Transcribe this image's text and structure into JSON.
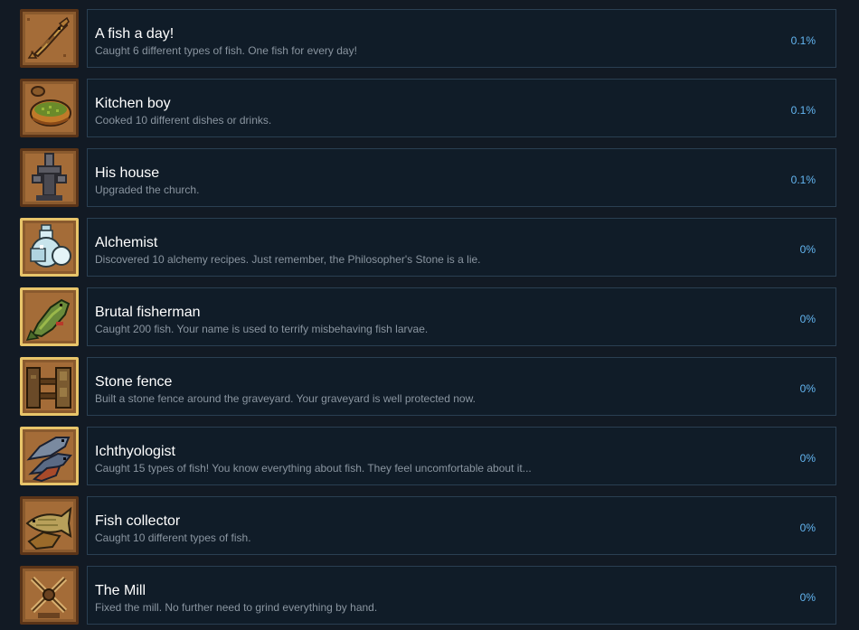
{
  "achievements": [
    {
      "icon": "fish-icon",
      "title": "A fish a day!",
      "description": "Caught 6 different types of fish. One fish for every day!",
      "percent": "0.1%"
    },
    {
      "icon": "soup-bowl-icon",
      "title": "Kitchen boy",
      "description": "Cooked 10 different dishes or drinks.",
      "percent": "0.1%"
    },
    {
      "icon": "church-icon",
      "title": "His house",
      "description": "Upgraded the church.",
      "percent": "0.1%"
    },
    {
      "icon": "potion-bottle-icon",
      "title": "Alchemist",
      "description": "Discovered 10 alchemy recipes. Just remember, the Philosopher's Stone is a lie.",
      "percent": "0%"
    },
    {
      "icon": "big-fish-icon",
      "title": "Brutal fisherman",
      "description": "Caught 200 fish. Your name is used to terrify misbehaving fish larvae.",
      "percent": "0%"
    },
    {
      "icon": "stone-fence-icon",
      "title": "Stone fence",
      "description": "Built a stone fence around the graveyard. Your graveyard is well protected now.",
      "percent": "0%"
    },
    {
      "icon": "fish-pile-icon",
      "title": "Ichthyologist",
      "description": "Caught 15 types of fish! You know everything about fish. They feel uncomfortable about it...",
      "percent": "0%"
    },
    {
      "icon": "fish-collection-icon",
      "title": "Fish collector",
      "description": "Caught 10 different types of fish.",
      "percent": "0%"
    },
    {
      "icon": "mill-icon",
      "title": "The Mill",
      "description": "Fixed the mill. No further need to grind everything by hand.",
      "percent": "0%"
    }
  ],
  "colors": {
    "background": "#121a24",
    "card": "#101c28",
    "card_border": "#2a3f52",
    "title": "#ffffff",
    "description": "#8a95a0",
    "percent": "#63b6f2",
    "icon_frame_gold": "#e8c56a",
    "icon_frame_brown": "#6b4420"
  }
}
